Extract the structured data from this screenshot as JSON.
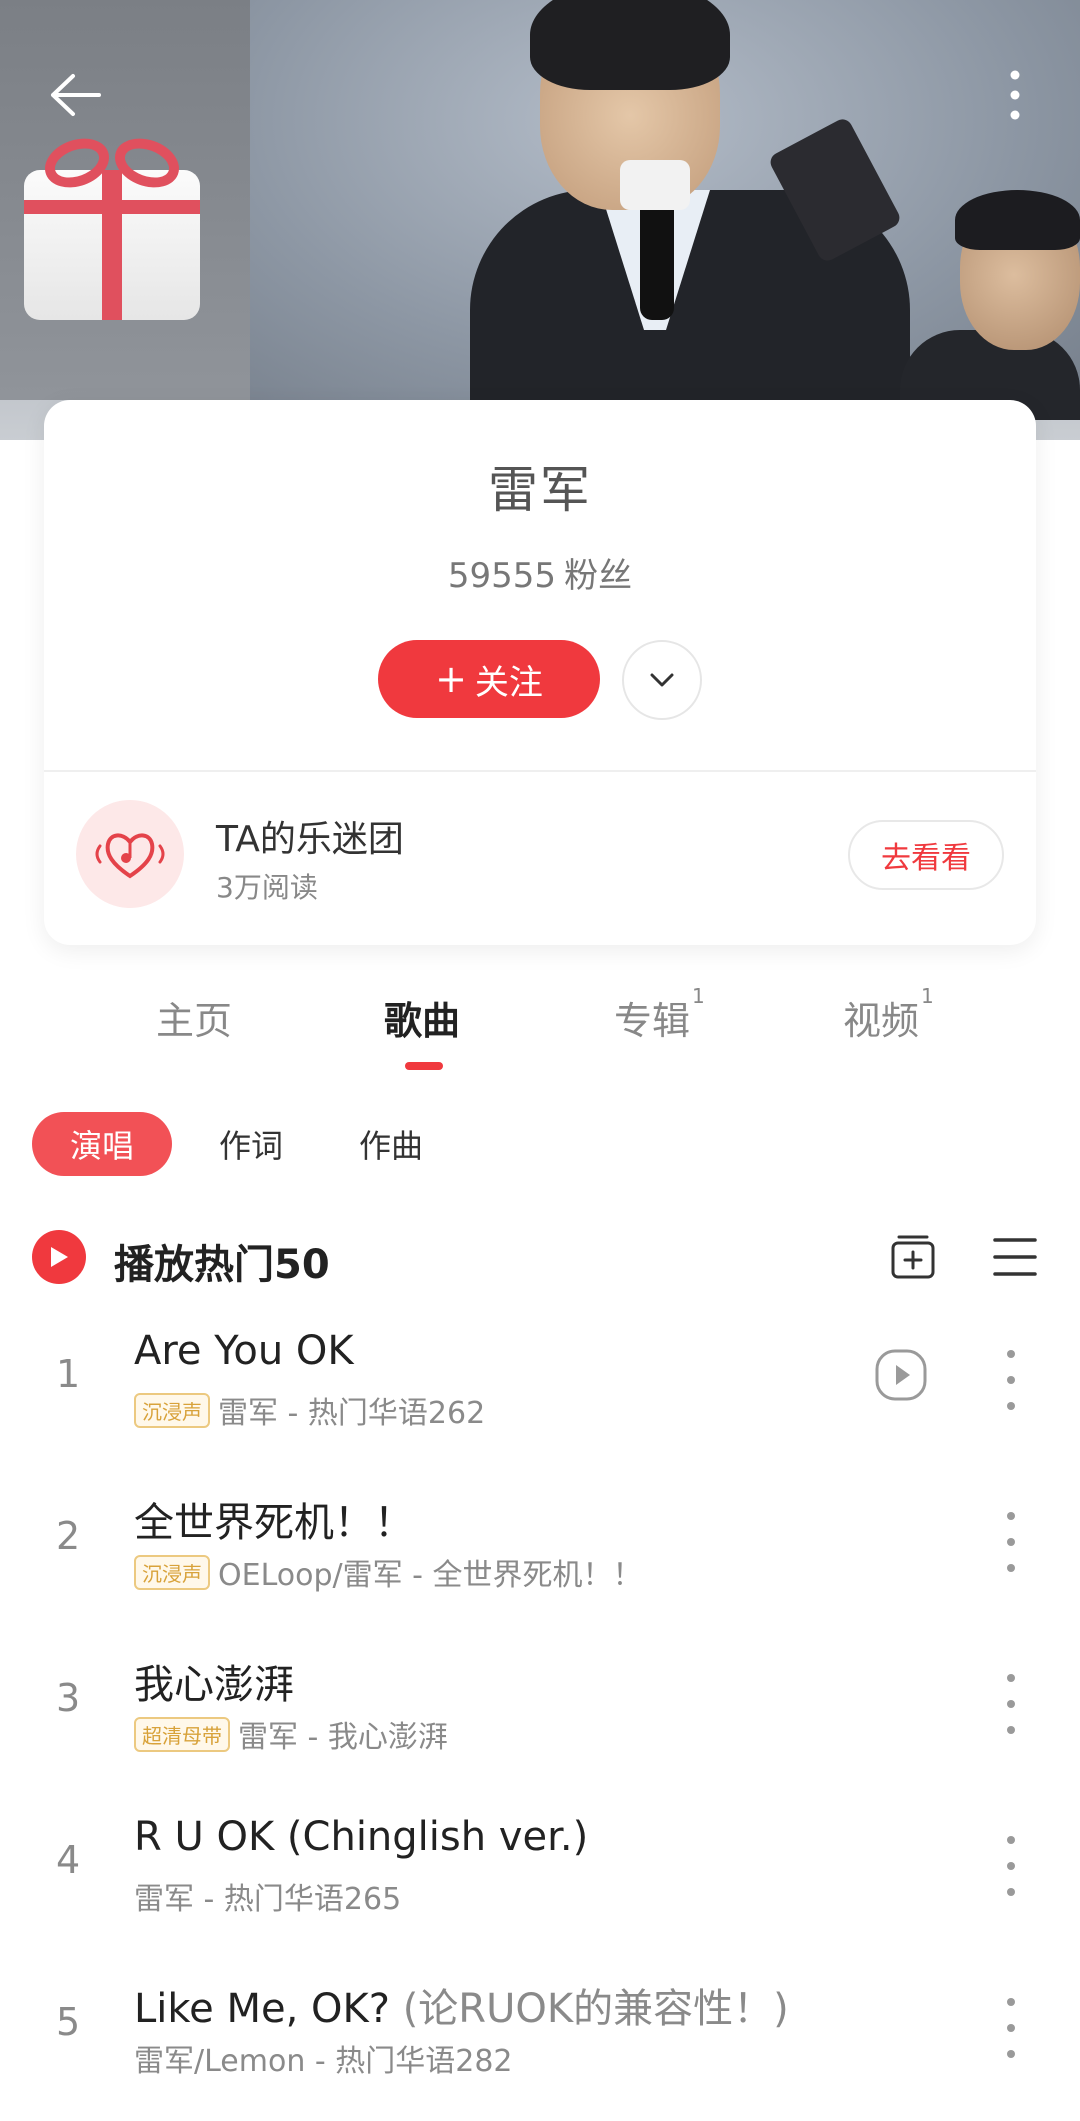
{
  "header": {
    "back_icon": "arrow-left-icon",
    "more_icon": "more-vertical-icon"
  },
  "profile": {
    "name": "雷军",
    "fans_count": "59555",
    "fans_label": "粉丝",
    "follow_plus": "+",
    "follow_label": "关注",
    "expand_icon": "chevron-down-icon"
  },
  "fanclub": {
    "title": "TA的乐迷团",
    "reads": "3万阅读",
    "button": "去看看"
  },
  "tabs": [
    {
      "label": "主页",
      "badge": ""
    },
    {
      "label": "歌曲",
      "badge": ""
    },
    {
      "label": "专辑",
      "badge": "1"
    },
    {
      "label": "视频",
      "badge": "1"
    }
  ],
  "active_tab": "歌曲",
  "filters": [
    {
      "label": "演唱"
    },
    {
      "label": "作词"
    },
    {
      "label": "作曲"
    }
  ],
  "play_hot": {
    "label": "播放热门50"
  },
  "songs": [
    {
      "index": "1",
      "title": "Are You OK",
      "title_alt": "",
      "tag": "沉浸声",
      "subtitle": "雷军 - 热门华语262",
      "has_mv": true
    },
    {
      "index": "2",
      "title": "全世界死机！！",
      "title_alt": "",
      "tag": "沉浸声",
      "subtitle": "OELoop/雷军 - 全世界死机！！",
      "has_mv": false
    },
    {
      "index": "3",
      "title": "我心澎湃",
      "title_alt": "",
      "tag": "超清母带",
      "subtitle": "雷军 - 我心澎湃",
      "has_mv": false
    },
    {
      "index": "4",
      "title": "R U OK (Chinglish ver.)",
      "title_alt": "",
      "tag": "",
      "subtitle": "雷军 - 热门华语265",
      "has_mv": false
    },
    {
      "index": "5",
      "title": "Like Me, OK?",
      "title_alt": "(论RUOK的兼容性！)",
      "tag": "",
      "subtitle": "雷军/Lemon - 热门华语282",
      "has_mv": false
    }
  ],
  "colors": {
    "accent": "#f0393e",
    "tag_gold": "#d8a23a"
  }
}
